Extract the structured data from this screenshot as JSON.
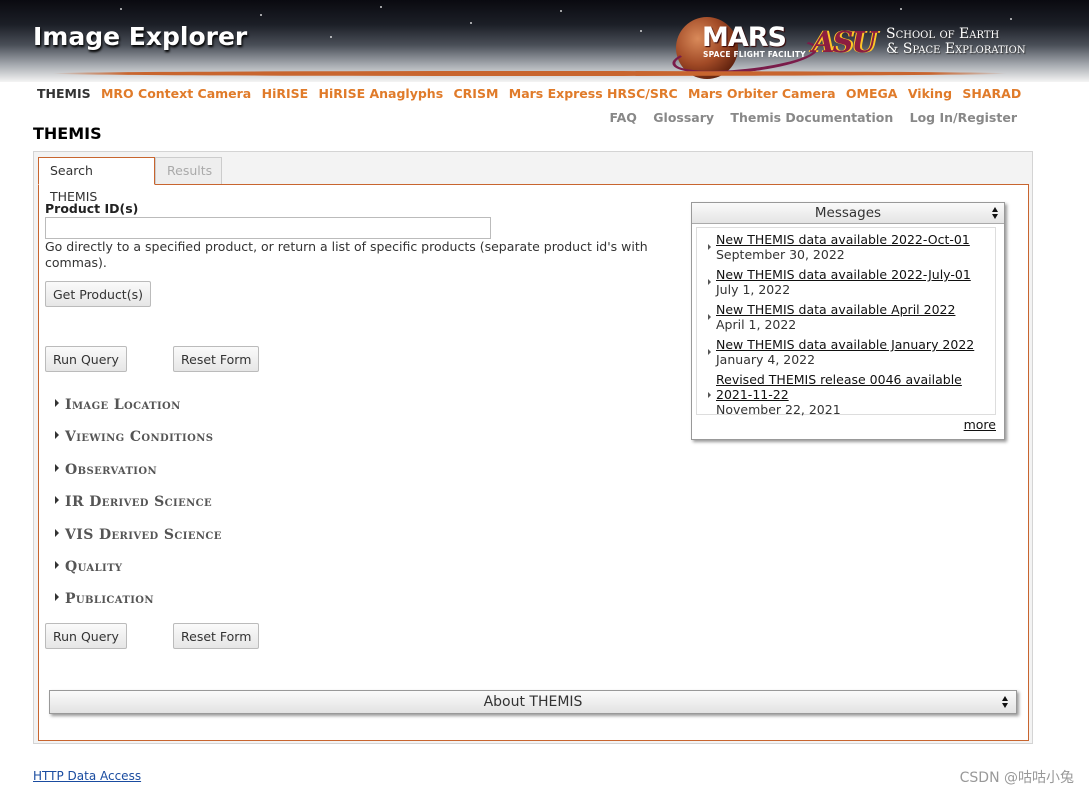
{
  "header": {
    "site_title": "Image Explorer",
    "mars_logo": "MARS",
    "mars_logo_sub": "SPACE FLIGHT FACILITY",
    "asu_logo": "ASU",
    "school_line1": "School of Earth",
    "school_line2": "& Space Exploration"
  },
  "instrument_nav": [
    {
      "label": "THEMIS",
      "active": true
    },
    {
      "label": "MRO Context Camera",
      "active": false
    },
    {
      "label": "HiRISE",
      "active": false
    },
    {
      "label": "HiRISE Anaglyphs",
      "active": false
    },
    {
      "label": "CRISM",
      "active": false
    },
    {
      "label": "Mars Express HRSC/SRC",
      "active": false
    },
    {
      "label": "Mars Orbiter Camera",
      "active": false
    },
    {
      "label": "OMEGA",
      "active": false
    },
    {
      "label": "Viking",
      "active": false
    },
    {
      "label": "SHARAD",
      "active": false
    }
  ],
  "util_nav": [
    "FAQ",
    "Glossary",
    "Themis Documentation",
    "Log In/Register"
  ],
  "page_title": "THEMIS",
  "tabs": [
    "Search THEMIS",
    "Results"
  ],
  "search": {
    "product_label": "Product ID(s)",
    "product_value": "",
    "product_help": "Go directly to a specified product, or return a list of specific products (separate product id's with commas).",
    "get_products_label": "Get Product(s)",
    "run_query_label": "Run Query",
    "reset_form_label": "Reset Form"
  },
  "sections": [
    "Image Location",
    "Viewing Conditions",
    "Observation",
    "IR Derived Science",
    "VIS Derived Science",
    "Quality",
    "Publication"
  ],
  "messages": {
    "title": "Messages",
    "items": [
      {
        "title": "New THEMIS data available 2022-Oct-01",
        "date": "September 30, 2022"
      },
      {
        "title": "New THEMIS data available 2022-July-01",
        "date": "July 1, 2022"
      },
      {
        "title": "New THEMIS data available April 2022",
        "date": "April 1, 2022"
      },
      {
        "title": "New THEMIS data available January 2022",
        "date": "January 4, 2022"
      },
      {
        "title": "Revised THEMIS release 0046 available 2021-11-22",
        "date": "November 22, 2021"
      }
    ],
    "more_label": "more"
  },
  "about_label": "About THEMIS",
  "footer": {
    "http_link": "HTTP Data Access",
    "watermark": "CSDN @咕咕小兔"
  },
  "colors": {
    "accent": "#e07b2a",
    "tab_border": "#c8652f",
    "link": "#1a4ca0"
  },
  "icons": [
    "updown-arrows-icon",
    "triangle-right-icon",
    "mars-planet-icon",
    "asu-logo-icon"
  ]
}
